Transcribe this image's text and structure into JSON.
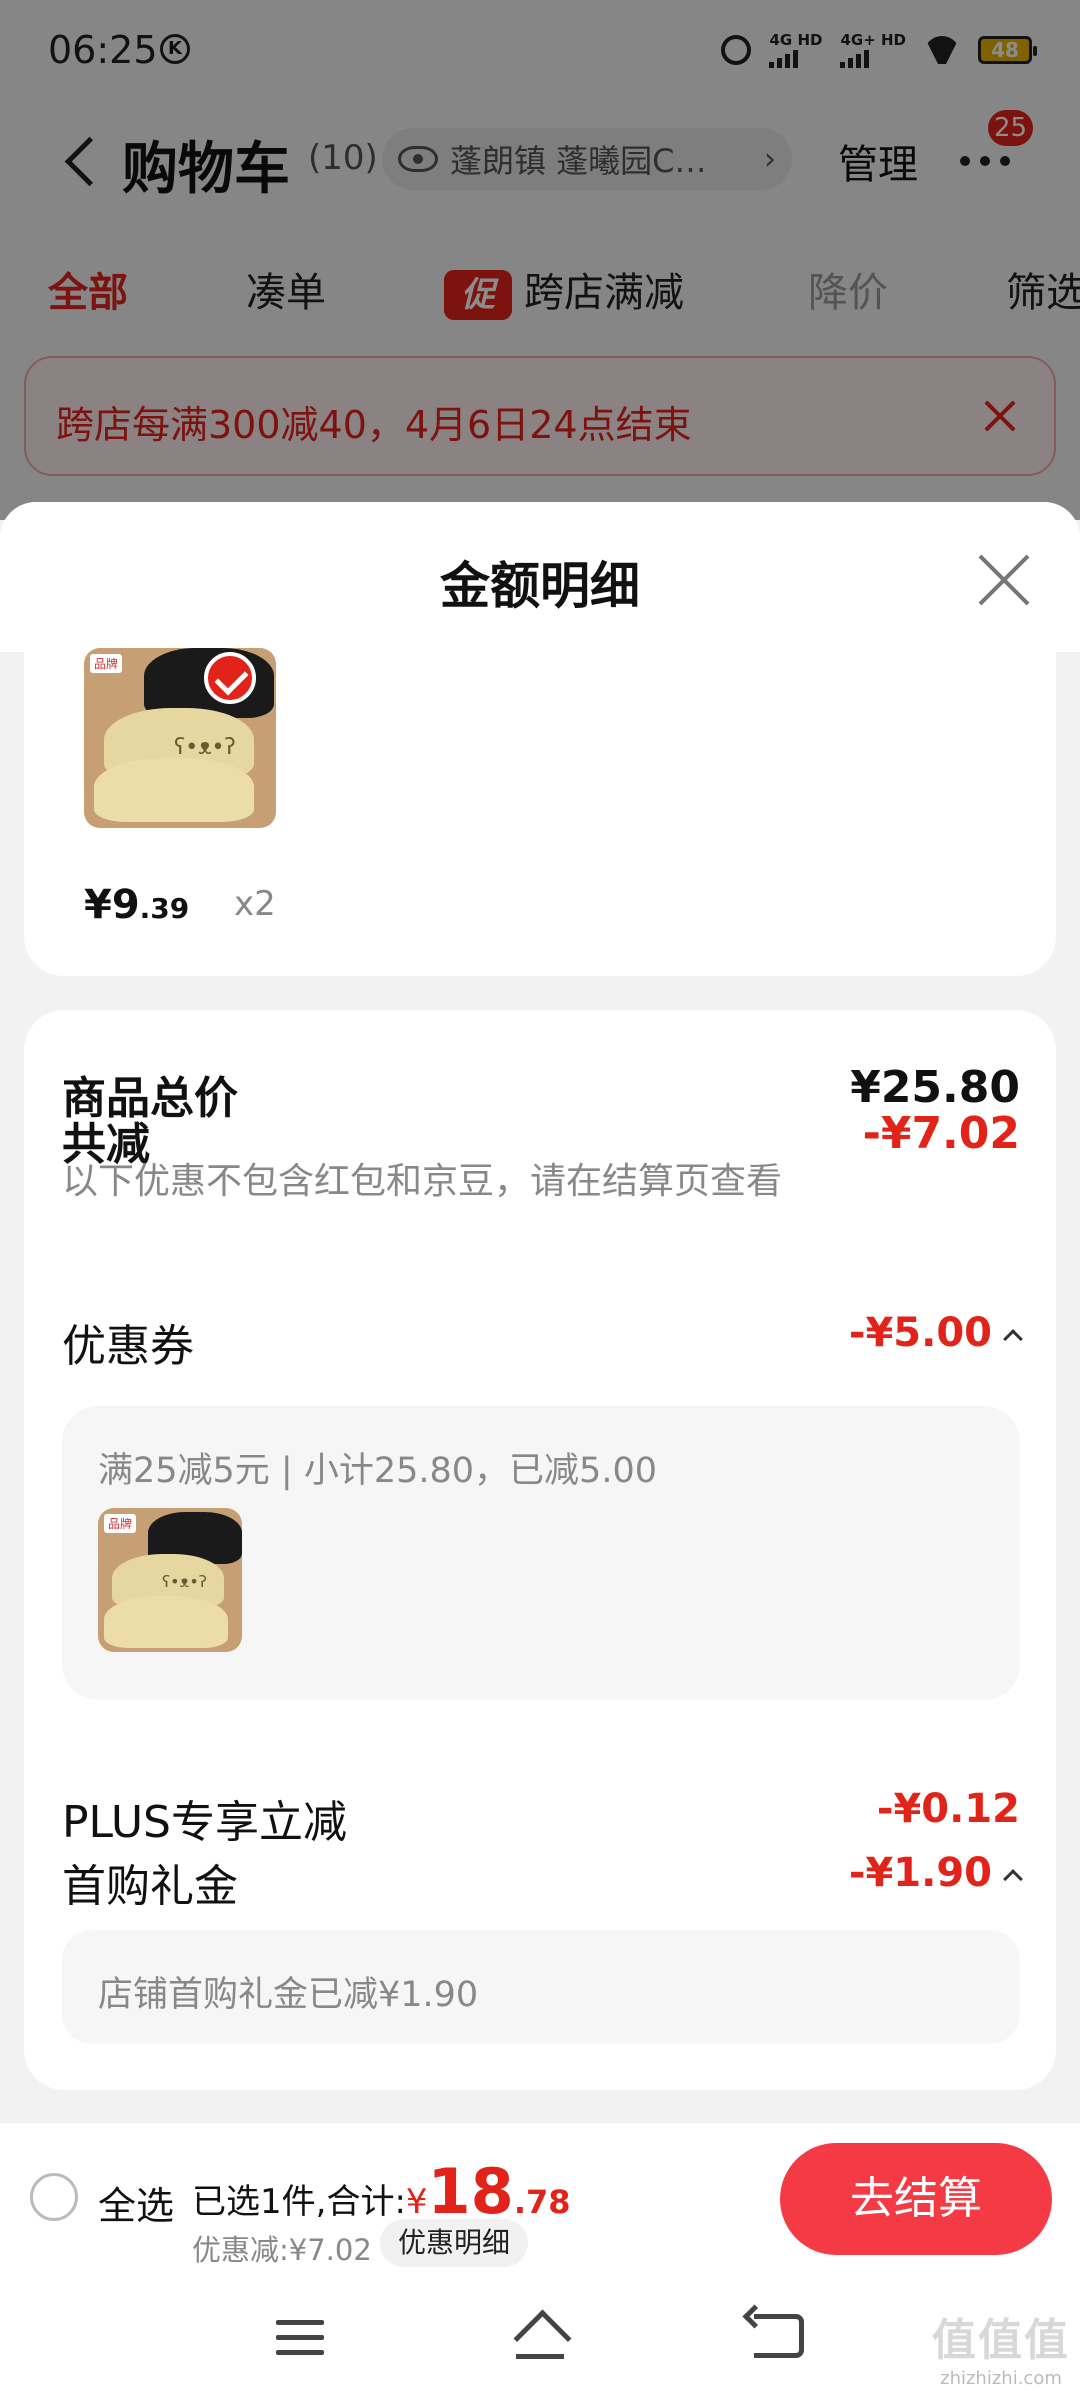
{
  "status_bar": {
    "time": "06:25",
    "network1_label": "4G HD",
    "network2_label": "4G+ HD",
    "battery": "48"
  },
  "nav": {
    "title": "购物车",
    "count": "(10)",
    "address": "蓬朗镇 蓬曦园C…",
    "manage_label": "管理",
    "notification_count": "25"
  },
  "tabs": [
    {
      "label": "全部",
      "state": "active"
    },
    {
      "label": "凑单",
      "state": "normal"
    },
    {
      "label": "跨店满减",
      "state": "normal",
      "icon": "促"
    },
    {
      "label": "降价",
      "state": "dim"
    },
    {
      "label": "筛选",
      "state": "normal"
    }
  ],
  "promo_banner": {
    "text": "跨店每满300减40，4月6日24点结束"
  },
  "sheet": {
    "title": "金额明细",
    "product": {
      "price_main": "¥9",
      "price_decimal": ".39",
      "quantity": "x2",
      "brand_tag": "品牌"
    },
    "total_price": {
      "label": "商品总价",
      "value": "¥25.80"
    },
    "total_discount": {
      "label": "共减",
      "value": "-¥7.02",
      "note": "以下优惠不包含红包和京豆，请在结算页查看"
    },
    "coupon": {
      "label": "优惠券",
      "value": "-¥5.00",
      "detail": "满25减5元 | 小计25.80，已减5.00"
    },
    "plus_discount": {
      "label": "PLUS专享立减",
      "value": "-¥0.12"
    },
    "first_buy_gift": {
      "label": "首购礼金",
      "value": "-¥1.90",
      "detail": "店铺首购礼金已减¥1.90"
    }
  },
  "checkout": {
    "select_all_label": "全选",
    "selected_prefix": "已选1件,合计:",
    "total_currency": "¥",
    "total_integer": "18",
    "total_decimal": ".78",
    "discount_text": "优惠减:¥7.02",
    "promo_detail_label": "优惠明细",
    "checkout_label": "去结算"
  },
  "watermark": {
    "logo": "值值值",
    "url": "zhizhizhi.com"
  },
  "colors": {
    "accent": "#e2231a",
    "checkout_button": "#f43b45"
  }
}
